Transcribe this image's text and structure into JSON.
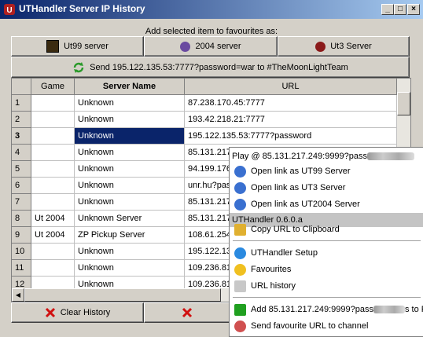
{
  "window": {
    "title": "UTHandler Server IP History"
  },
  "favourites": {
    "label": "Add selected item to favourites as:",
    "ut99": "Ut99 server",
    "ut2004": "2004 server",
    "ut3": "Ut3 Server"
  },
  "send_button": "Send 195.122.135.53:7777?password=war to #TheMoonLightTeam",
  "table": {
    "headers": {
      "game": "Game",
      "name": "Server Name",
      "url": "URL"
    },
    "rows": [
      {
        "n": "1",
        "game": "",
        "name": "Unknown",
        "url": "87.238.170.45:7777"
      },
      {
        "n": "2",
        "game": "",
        "name": "Unknown",
        "url": "193.42.218.21:7777"
      },
      {
        "n": "3",
        "game": "",
        "name": "Unknown",
        "url": "195.122.135.53:7777?password"
      },
      {
        "n": "4",
        "game": "",
        "name": "Unknown",
        "url": "85.131.217"
      },
      {
        "n": "5",
        "game": "",
        "name": "Unknown",
        "url": "94.199.176"
      },
      {
        "n": "6",
        "game": "",
        "name": "Unknown",
        "url": "unr.hu?pass"
      },
      {
        "n": "7",
        "game": "",
        "name": "Unknown",
        "url": "85.131.217"
      },
      {
        "n": "8",
        "game": "Ut 2004",
        "name": "Unknown Server",
        "url": "85.131.217"
      },
      {
        "n": "9",
        "game": "Ut 2004",
        "name": "ZP Pickup Server",
        "url": "108.61.254"
      },
      {
        "n": "10",
        "game": "",
        "name": "Unknown",
        "url": "195.122.13"
      },
      {
        "n": "11",
        "game": "",
        "name": "Unknown",
        "url": "109.236.81"
      },
      {
        "n": "12",
        "game": "",
        "name": "Unknown",
        "url": "109.236.81"
      }
    ]
  },
  "bottom": {
    "clear": "Clear History"
  },
  "menu": {
    "play": "Play @ 85.131.217.249:9999?pass",
    "open_ut99": "Open link as UT99 Server",
    "open_ut3": "Open link as UT3 Server",
    "open_ut2004": "Open link as UT2004 Server",
    "version": "UTHandler 0.6.0.a",
    "copy": "Copy URL to Clipboard",
    "setup": "UTHandler Setup",
    "favourites": "Favourites",
    "history": "URL history",
    "add": "Add 85.131.217.249:9999?pass",
    "add_tail": "s to F",
    "send": "Send favourite URL to channel"
  }
}
